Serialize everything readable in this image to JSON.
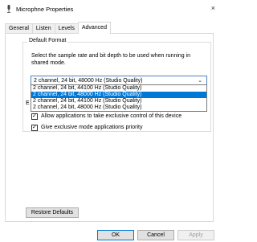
{
  "window": {
    "title": "Microphne Properties",
    "close_glyph": "×"
  },
  "tabs": [
    {
      "label": "General"
    },
    {
      "label": "Listen"
    },
    {
      "label": "Levels"
    },
    {
      "label": "Advanced"
    }
  ],
  "default_format": {
    "group_title": "Default Format",
    "description": "Select the sample rate and bit depth to be used when running in shared mode.",
    "selected_value": "2 channel, 24 bit, 48000 Hz (Studio Quality)",
    "options": [
      "2 channel, 24 bit, 44100 Hz (Studio Quality)",
      "2 channel, 24 bit, 48000 Hz (Studio Quality)",
      "2 channel, 24 bit, 44100 Hz (Studio Quality)",
      "2 channel, 24 bit, 48000 Hz (Studio Quality)"
    ],
    "highlighted_index": 1
  },
  "exclusive": {
    "group_title_visible": "E",
    "allow_label": "Allow applications to take exclusive control of this device",
    "priority_label": "Give exclusive mode applications priority"
  },
  "buttons": {
    "restore": "Restore Defaults",
    "ok": "OK",
    "cancel": "Cancel",
    "apply": "Apply"
  }
}
